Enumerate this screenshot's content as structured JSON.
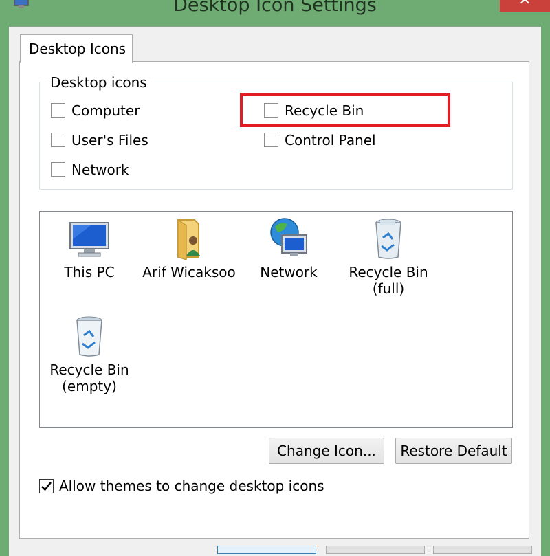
{
  "window": {
    "title": "Desktop Icon Settings"
  },
  "tabs": [
    {
      "label": "Desktop Icons"
    }
  ],
  "group": {
    "label": "Desktop icons",
    "checkboxes": [
      {
        "label": "Computer",
        "checked": false
      },
      {
        "label": "Recycle Bin",
        "checked": false
      },
      {
        "label": "User's Files",
        "checked": false
      },
      {
        "label": "Control Panel",
        "checked": false
      },
      {
        "label": "Network",
        "checked": false
      }
    ]
  },
  "icons": [
    {
      "label": "This PC"
    },
    {
      "label": "Arif Wicaksoo"
    },
    {
      "label": "Network"
    },
    {
      "label": "Recycle Bin\n(full)"
    },
    {
      "label": "Recycle Bin\n(empty)"
    }
  ],
  "buttons": {
    "change_icon": "Change Icon...",
    "restore_default": "Restore Default"
  },
  "allow_themes": {
    "label": "Allow themes to change desktop icons",
    "checked": true
  },
  "colors": {
    "highlight": "#e01c24",
    "window_frame": "#6fac74",
    "close_button": "#c9413a"
  }
}
